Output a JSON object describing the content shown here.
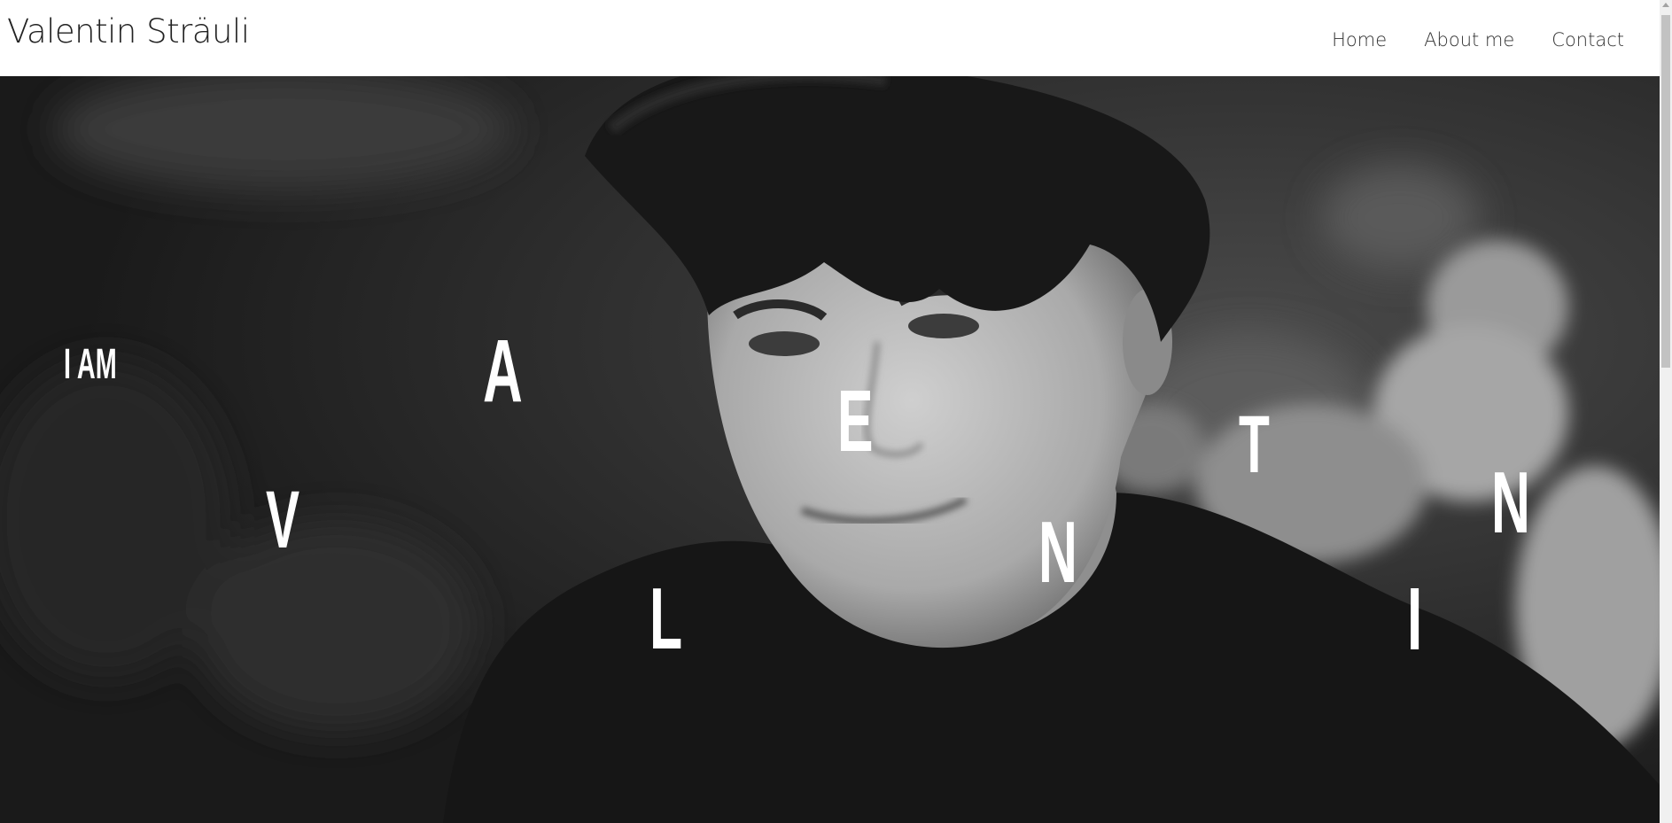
{
  "header": {
    "brand": "Valentin Sträuli",
    "nav": [
      {
        "label": "Home"
      },
      {
        "label": "About me"
      },
      {
        "label": "Contact"
      }
    ]
  },
  "hero": {
    "intro": "I AM",
    "letters": [
      "V",
      "A",
      "L",
      "E",
      "N",
      "T",
      "I",
      "N"
    ],
    "text_color": "#ffffff"
  }
}
